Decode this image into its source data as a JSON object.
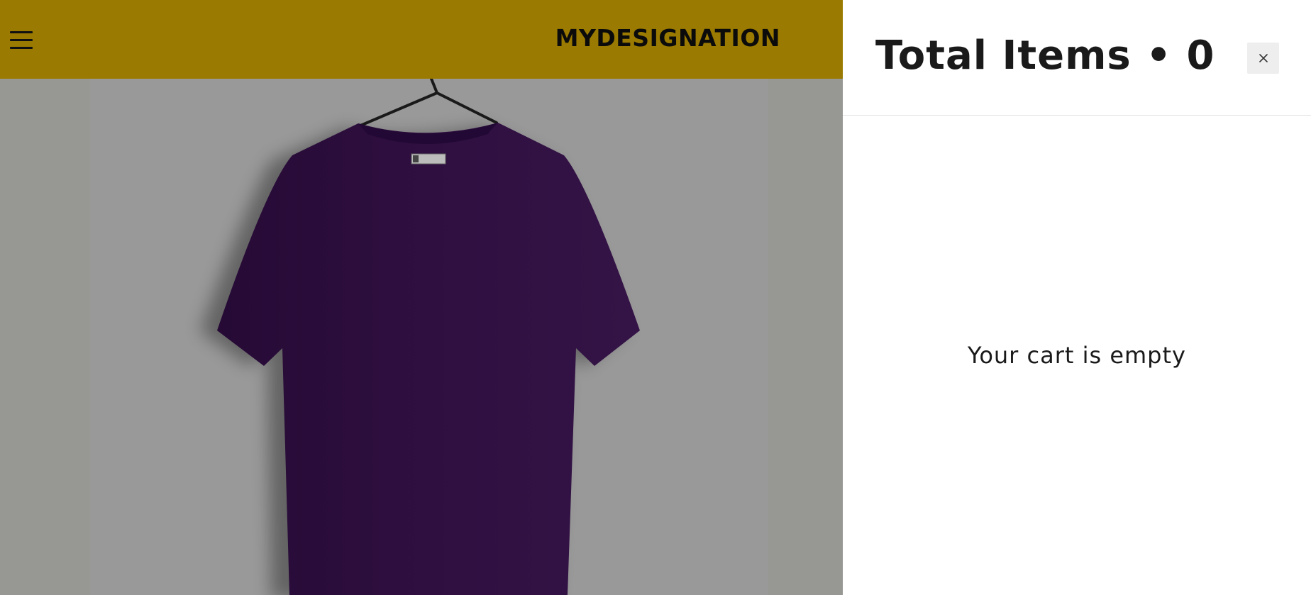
{
  "header": {
    "menu_icon": "hamburger-icon",
    "logo_text": "MYDESIGNATION"
  },
  "hero": {
    "product_color": "#2e0f3f"
  },
  "cart": {
    "title": "Total Items • 0",
    "close_icon": "close-icon",
    "empty_message": "Your cart is empty"
  },
  "colors": {
    "header_bg": "#9a7a00",
    "overlay_bg": "#979893",
    "drawer_bg": "#ffffff"
  }
}
